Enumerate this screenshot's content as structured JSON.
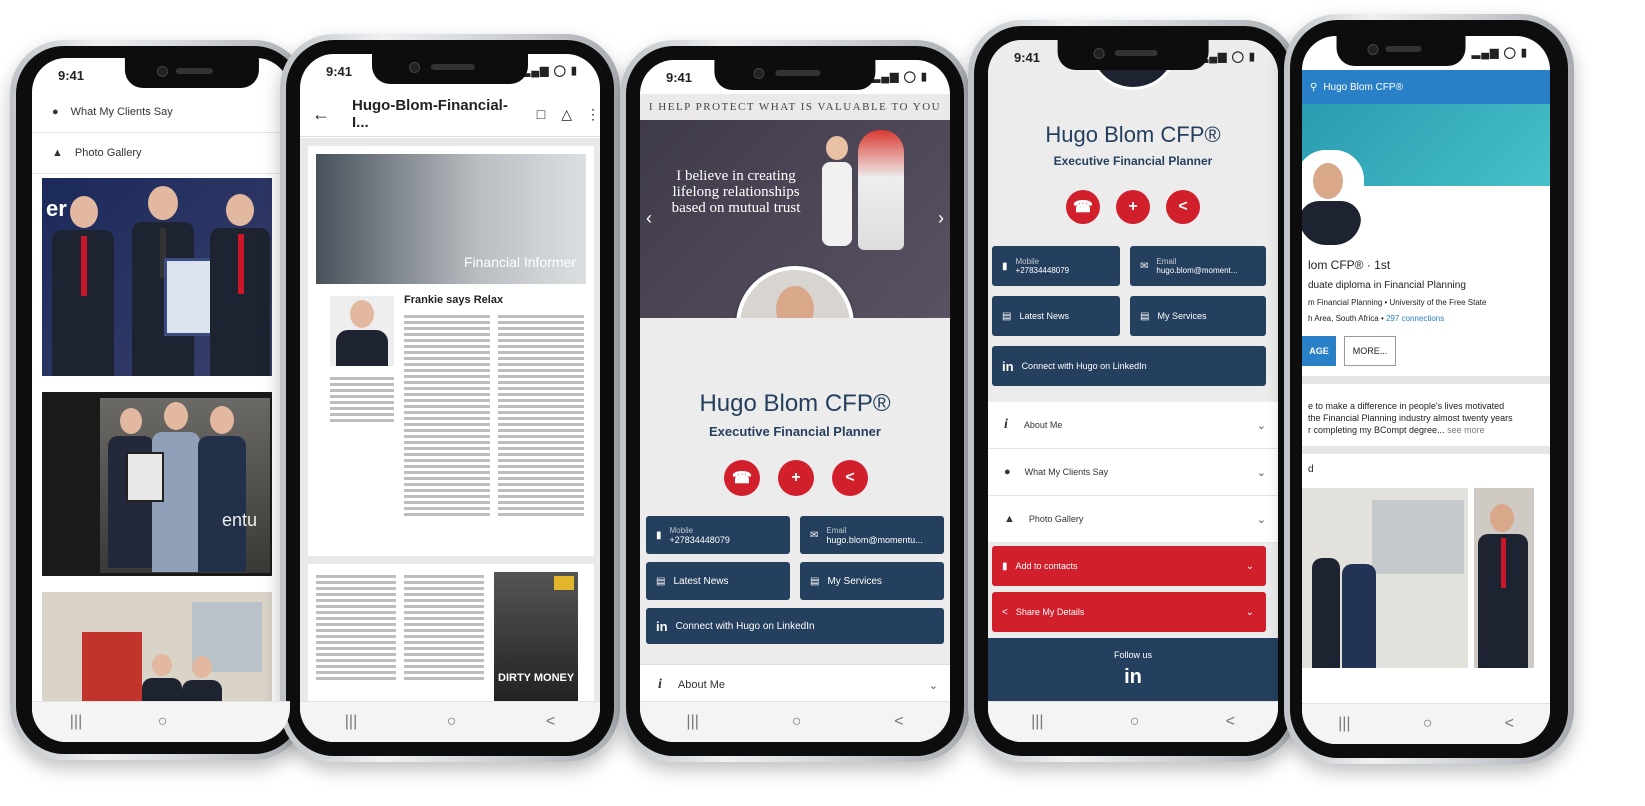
{
  "status": {
    "time": "9:41"
  },
  "phone1": {
    "menu": [
      {
        "icon": "chat-icon",
        "label": "What My Clients Say"
      },
      {
        "icon": "gallery-icon",
        "label": "Photo Gallery"
      }
    ],
    "photo1_text": "er",
    "photo2_text": "entu"
  },
  "phone2": {
    "title": "Hugo-Blom-Financial-I...",
    "banner": "Financial Informer",
    "article_title": "Frankie says Relax",
    "book_title": "DIRTY MONEY"
  },
  "phone3": {
    "tagline": "I HELP PROTECT WHAT IS VALUABLE TO YOU",
    "quote": "I believe in creating lifelong relationships based on mutual trust",
    "name": "Hugo Blom CFP®",
    "role": "Executive Financial Planner",
    "mobile_label": "Mobile",
    "mobile_value": "+27834448079",
    "email_label": "Email",
    "email_value": "hugo.blom@momentu...",
    "latest_news": "Latest News",
    "my_services": "My Services",
    "linkedin": "Connect with Hugo on LinkedIn",
    "about": "About Me"
  },
  "phone4": {
    "name": "Hugo Blom CFP®",
    "role": "Executive Financial Planner",
    "mobile_label": "Mobile",
    "mobile_value": "+27834448079",
    "email_label": "Email",
    "email_value": "hugo.blom@moment...",
    "latest_news": "Latest News",
    "my_services": "My Services",
    "linkedin": "Connect with Hugo on LinkedIn",
    "menu": [
      {
        "icon": "info-icon",
        "label": "About Me"
      },
      {
        "icon": "chat-icon",
        "label": "What My Clients Say"
      },
      {
        "icon": "gallery-icon",
        "label": "Photo Gallery"
      }
    ],
    "add_contacts": "Add to contacts",
    "share": "Share My Details",
    "follow": "Follow us",
    "in_logo": "in"
  },
  "phone5": {
    "search": "Hugo Blom CFP®",
    "name_line": "lom CFP® · 1st",
    "line1": "duate diploma in Financial Planning",
    "line2": "m Financial Planning • University of the Free State",
    "line3": "h Area, South Africa",
    "connections": "297 connections",
    "btn_left": "AGE",
    "btn_more": "MORE...",
    "about1": "e to make a difference in people's lives motivated",
    "about2": "the Financial Planning industry almost twenty years",
    "about3": "r completing my BCompt degree...",
    "see_more": "see more",
    "section_mark": "d"
  },
  "colors": {
    "navy": "#253f5e",
    "red": "#d11f2b",
    "linkedin": "#2a80c7"
  }
}
